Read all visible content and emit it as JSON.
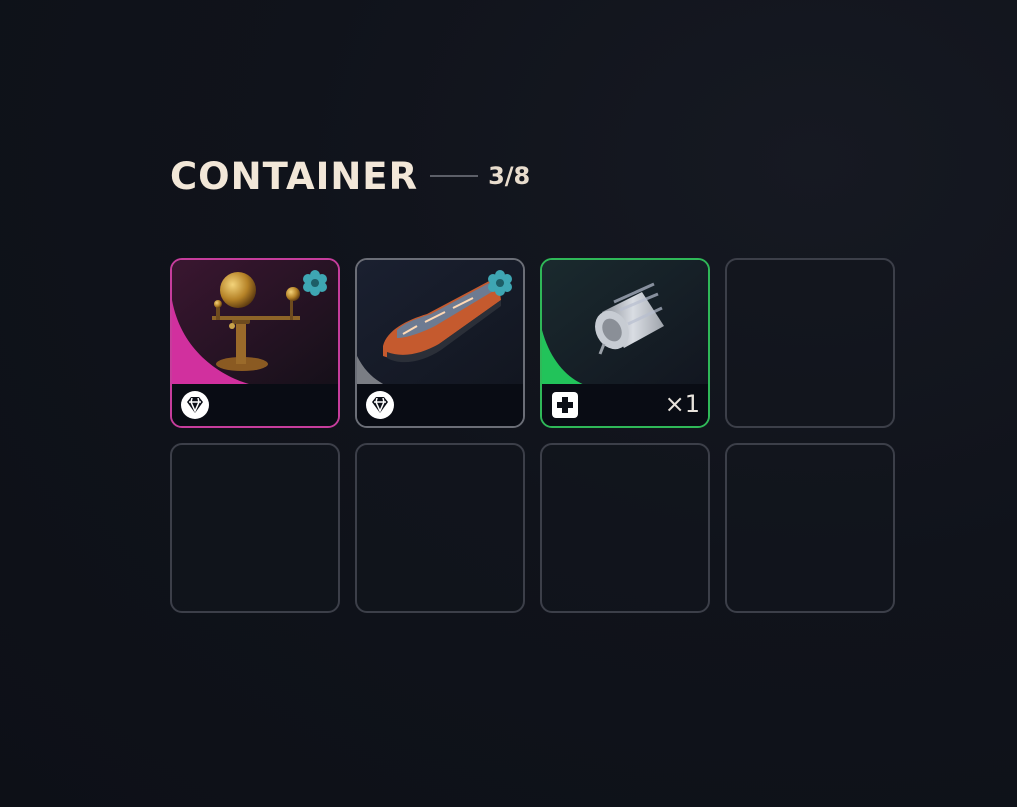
{
  "container": {
    "title": "CONTAINER",
    "count": "3/8"
  },
  "slots": [
    {
      "item": "orrery",
      "rarity": "pink",
      "rarity_color": "#c63d9c",
      "footer_icon": "diamond-icon",
      "badge_icon": "flower-icon",
      "quantity": ""
    },
    {
      "item": "train",
      "rarity": "gray",
      "rarity_color": "#6b6e77",
      "footer_icon": "diamond-icon",
      "badge_icon": "flower-icon",
      "quantity": ""
    },
    {
      "item": "bandage",
      "rarity": "green",
      "rarity_color": "#2fb858",
      "footer_icon": "medical-plus-icon",
      "badge_icon": "",
      "quantity": "×1"
    },
    {
      "item": "",
      "empty": true
    },
    {
      "item": "",
      "empty": true
    },
    {
      "item": "",
      "empty": true
    },
    {
      "item": "",
      "empty": true
    },
    {
      "item": "",
      "empty": true
    }
  ],
  "colors": {
    "title": "#f2e7d8",
    "slot_border": "#3c3f49",
    "badge": "#3ea6b3"
  }
}
